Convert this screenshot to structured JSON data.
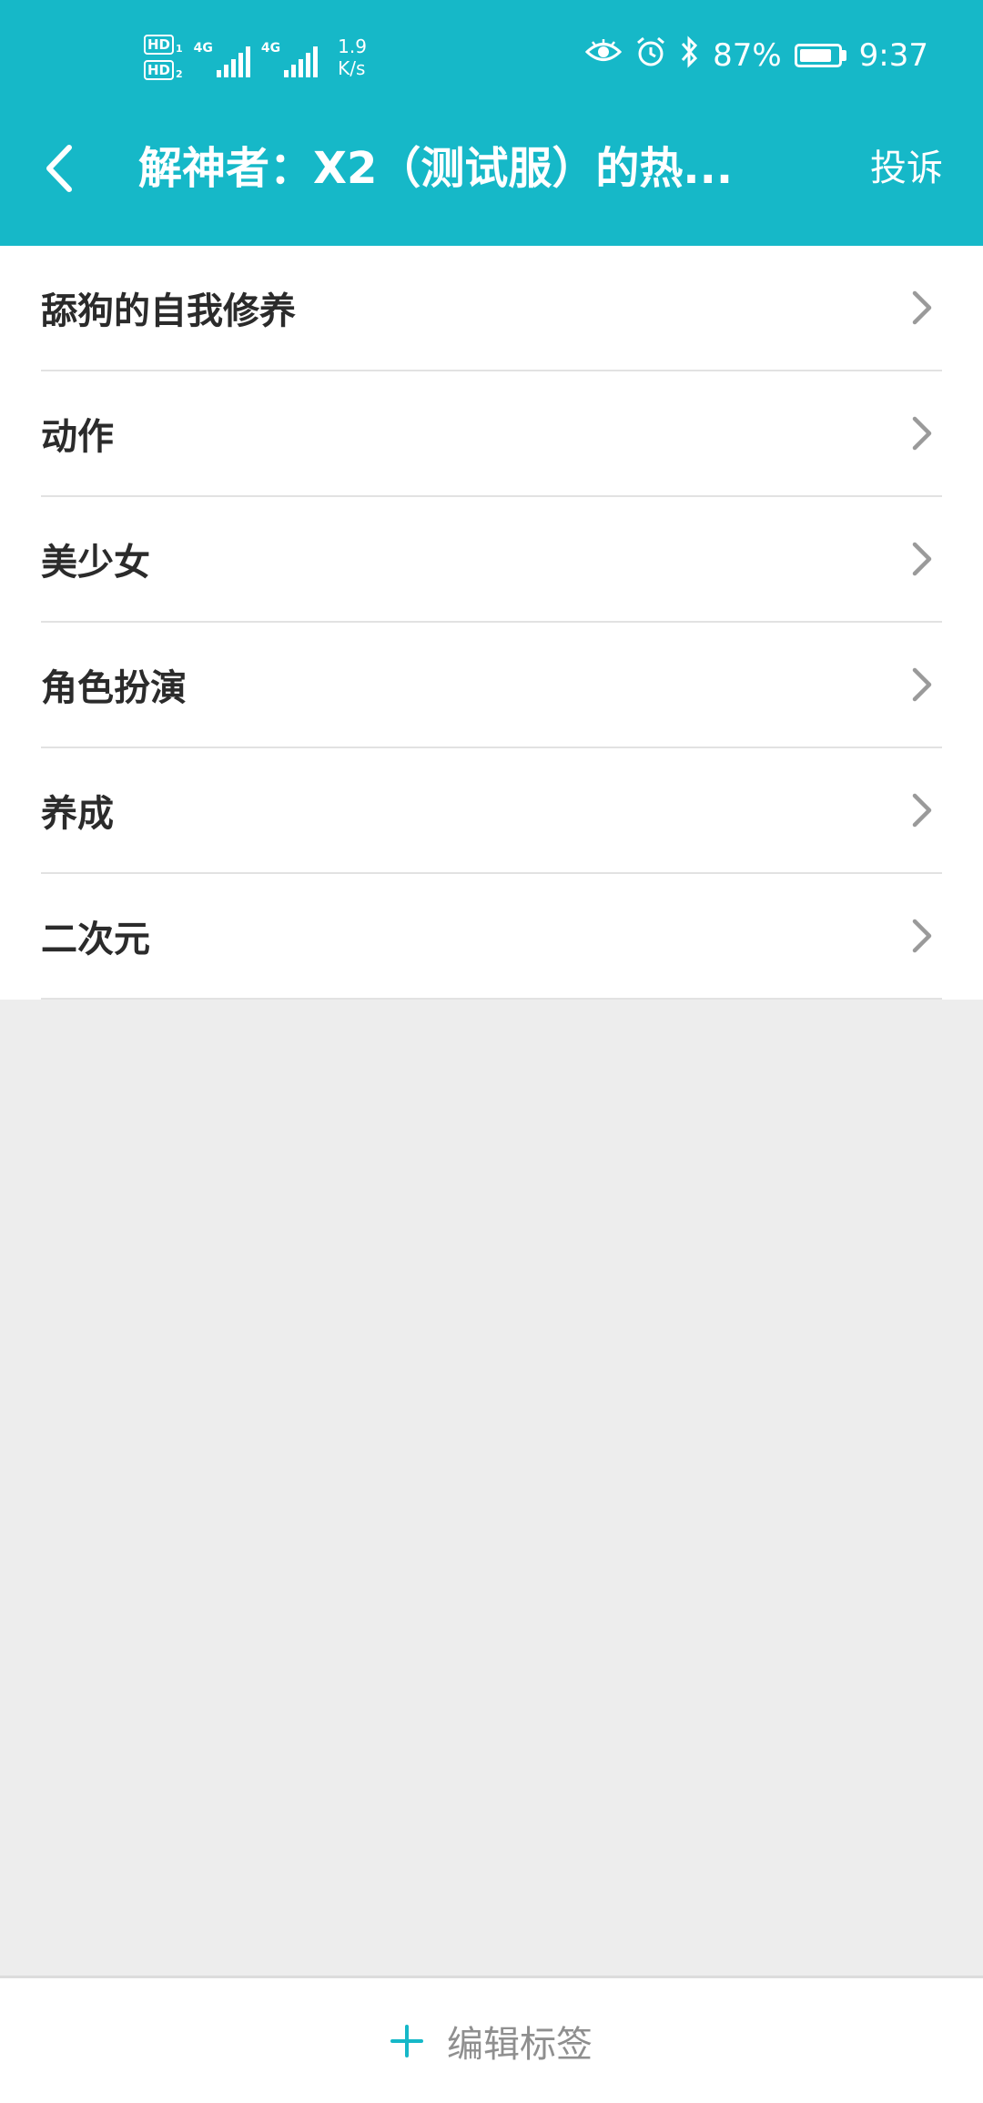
{
  "colors": {
    "accent": "#16b8c8",
    "page_background": "#ededed",
    "list_background": "#ffffff",
    "label_text": "#2b2b2b",
    "chevron": "#9a9a9a",
    "bottom_label": "#8f8f8f"
  },
  "status_bar": {
    "sim1_label": "HD",
    "sim1_index": "1",
    "sim2_label": "HD",
    "sim2_index": "2",
    "network1": "4G",
    "network2": "4G",
    "speed_value": "1.9",
    "speed_unit": "K/s",
    "battery_percent": "87%",
    "battery_level": 0.87,
    "time": "9:37",
    "icons": [
      "eye-comfort-icon",
      "alarm-icon",
      "bluetooth-icon",
      "battery-icon"
    ]
  },
  "header": {
    "title": "解神者：X2（测试服）的热...",
    "report_label": "投诉",
    "back_icon": "chevron-left-icon"
  },
  "tags": [
    {
      "label": "舔狗的自我修养"
    },
    {
      "label": "动作"
    },
    {
      "label": "美少女"
    },
    {
      "label": "角色扮演"
    },
    {
      "label": "养成"
    },
    {
      "label": "二次元"
    }
  ],
  "bottom_bar": {
    "edit_label": "编辑标签",
    "edit_icon": "plus-icon"
  }
}
